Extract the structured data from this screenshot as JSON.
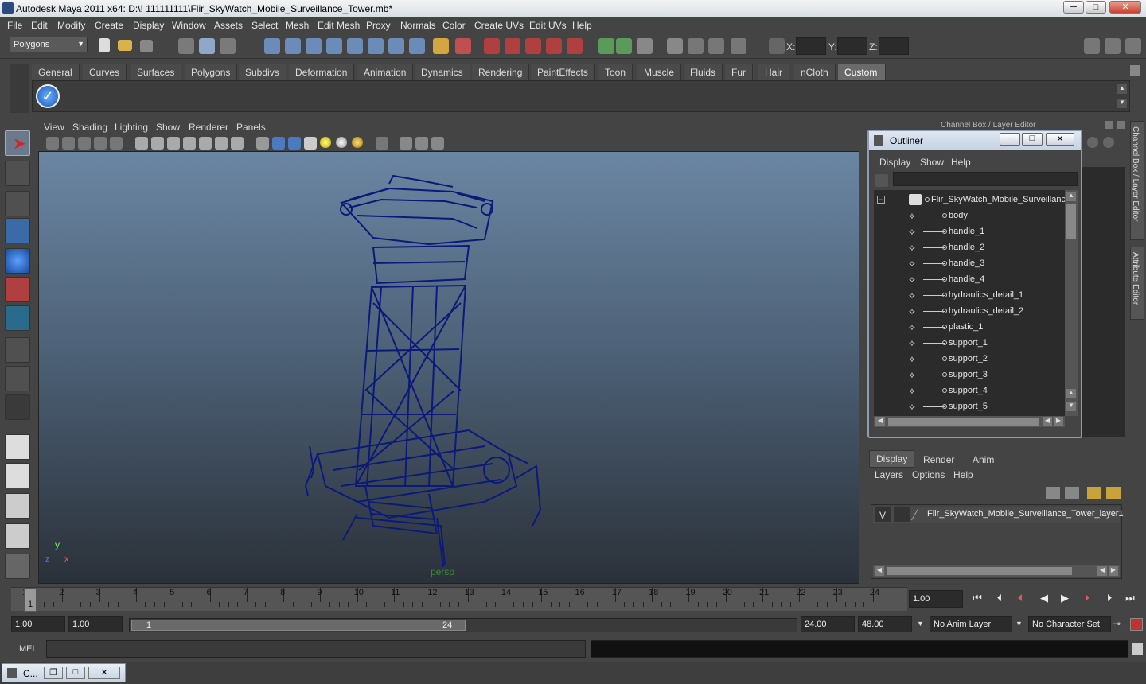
{
  "window": {
    "title": "Autodesk Maya 2011 x64: D:\\! 111111111\\Flir_SkyWatch_Mobile_Surveillance_Tower.mb*",
    "min": "─",
    "max": "□",
    "close": "✕"
  },
  "menu": [
    "File",
    "Edit",
    "Modify",
    "Create",
    "Display",
    "Window",
    "Assets",
    "Select",
    "Mesh",
    "Edit Mesh",
    "Proxy",
    "Normals",
    "Color",
    "Create UVs",
    "Edit UVs",
    "Help"
  ],
  "status": {
    "mode": "Polygons",
    "x_label": "X:",
    "y_label": "Y:",
    "z_label": "Z:"
  },
  "shelf_tabs": [
    "General",
    "Curves",
    "Surfaces",
    "Polygons",
    "Subdivs",
    "Deformation",
    "Animation",
    "Dynamics",
    "Rendering",
    "PaintEffects",
    "Toon",
    "Muscle",
    "Fluids",
    "Fur",
    "Hair",
    "nCloth",
    "Custom"
  ],
  "shelf_active": "Custom",
  "viewport": {
    "menu": [
      "View",
      "Shading",
      "Lighting",
      "Show",
      "Renderer",
      "Panels"
    ],
    "camera_label": "persp",
    "axis_y": "y",
    "axis_x": "x",
    "axis_z": "z"
  },
  "right_panel": {
    "channel_box_title": "Channel Box / Layer Editor",
    "side_tab_1": "Channel Box / Layer Editor",
    "side_tab_2": "Attribute Editor"
  },
  "outliner": {
    "title": "Outliner",
    "menu": [
      "Display",
      "Show",
      "Help"
    ],
    "root": "Flir_SkyWatch_Mobile_Surveillance",
    "items": [
      "body",
      "handle_1",
      "handle_2",
      "handle_3",
      "handle_4",
      "hydraulics_detail_1",
      "hydraulics_detail_2",
      "plastic_1",
      "support_1",
      "support_2",
      "support_3",
      "support_4",
      "support_5"
    ]
  },
  "layers": {
    "tabs": [
      "Display",
      "Render",
      "Anim"
    ],
    "active_tab": "Display",
    "menu": [
      "Layers",
      "Options",
      "Help"
    ],
    "layer_visible": "V",
    "layer_name": "Flir_SkyWatch_Mobile_Surveillance_Tower_layer1"
  },
  "timeline": {
    "ticks": [
      "1",
      "2",
      "3",
      "4",
      "5",
      "6",
      "7",
      "8",
      "9",
      "10",
      "11",
      "12",
      "13",
      "14",
      "15",
      "16",
      "17",
      "18",
      "19",
      "20",
      "21",
      "22",
      "23",
      "24"
    ],
    "current_frame": "1",
    "current_time": "1.00"
  },
  "range": {
    "start_time": "1.00",
    "start_playback": "1.00",
    "slider_start": "1",
    "slider_end": "24",
    "end_playback": "24.00",
    "end_time": "48.00",
    "anim_layer": "No Anim Layer",
    "char_set": "No Character Set"
  },
  "mel": {
    "label": "MEL"
  },
  "taskbar": {
    "item": "C...",
    "restore": "❐",
    "max": "□",
    "close": "✕"
  },
  "colors": {
    "wire": "#0a1a7a",
    "accent": "#8a9db5"
  }
}
